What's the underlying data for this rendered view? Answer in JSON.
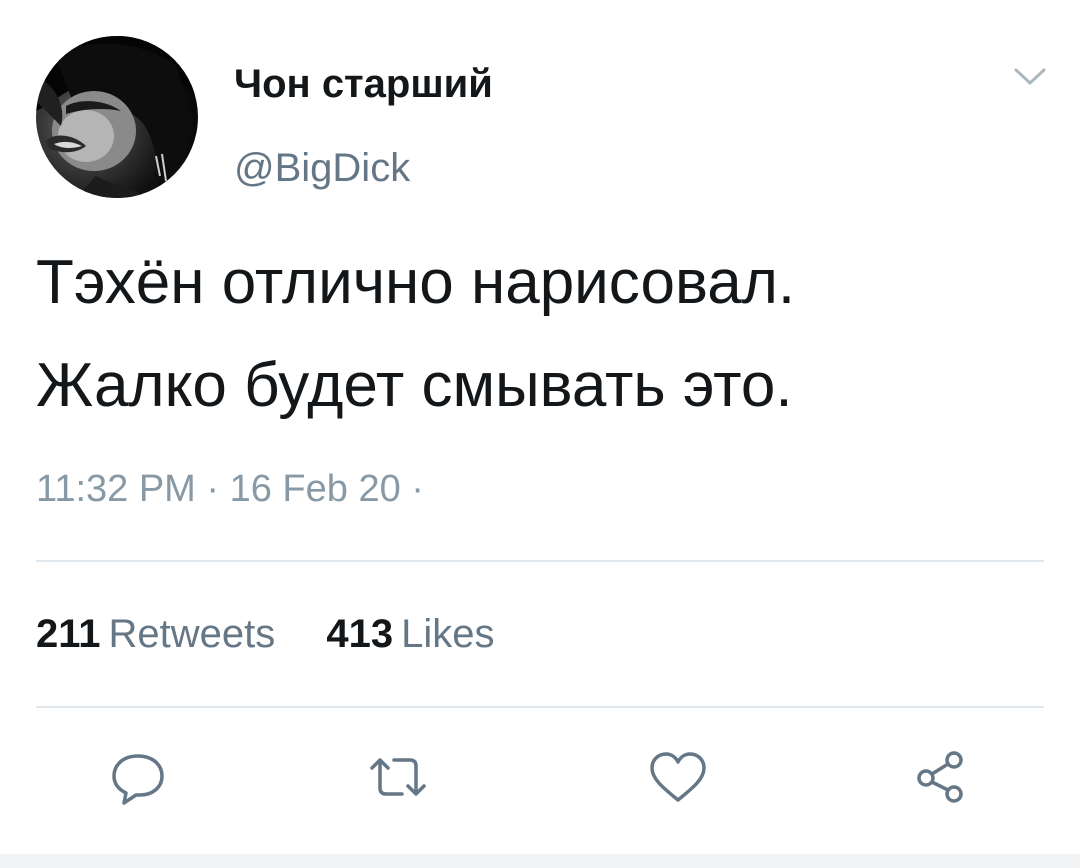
{
  "author": {
    "display_name": "Чон старший",
    "handle": "@BigDick",
    "avatar": "avatar-photo"
  },
  "tweet": {
    "lines": [
      "Тэхён отлично нарисовал.",
      "Жалко будет смывать это."
    ],
    "timestamp": "11:32 PM · 16 Feb 20 ·"
  },
  "stats": {
    "retweets_count": "211",
    "retweets_label": "Retweets",
    "likes_count": "413",
    "likes_label": "Likes"
  },
  "actions": {
    "icons": [
      "reply-icon",
      "retweet-icon",
      "like-icon",
      "share-icon"
    ]
  },
  "colors": {
    "text_primary": "#14171a",
    "text_secondary": "#657786",
    "icon_gray": "#657786",
    "divider": "#e1e8ed"
  }
}
